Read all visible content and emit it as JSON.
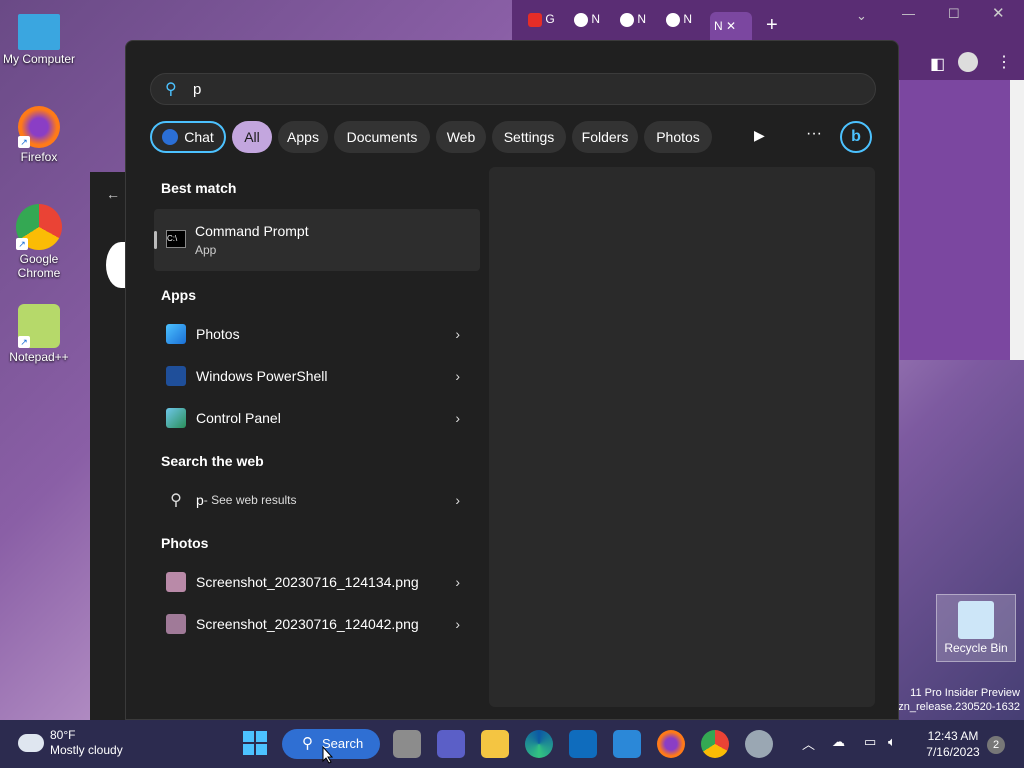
{
  "desktop": {
    "icons": [
      {
        "label": "My Computer"
      },
      {
        "label": "Firefox"
      },
      {
        "label": "Google Chrome"
      },
      {
        "label": "Notepad++"
      }
    ],
    "recycle_bin": "Recycle Bin",
    "watermark_line1": "11 Pro Insider Preview",
    "watermark_line2": "o.zn_release.230520-1632"
  },
  "browser": {
    "tabs": [
      "G",
      "N",
      "N",
      "N",
      "N"
    ],
    "new_tab": "+"
  },
  "search": {
    "query": "p",
    "filters": [
      "Chat",
      "All",
      "Apps",
      "Documents",
      "Web",
      "Settings",
      "Folders",
      "Photos"
    ],
    "active_filter": "All",
    "more": "···",
    "sections": {
      "best_match": "Best match",
      "apps": "Apps",
      "search_web": "Search the web",
      "photos": "Photos"
    },
    "best_match": {
      "title": "Command Prompt",
      "subtitle": "App"
    },
    "apps": [
      {
        "label": "Photos"
      },
      {
        "label": "Windows PowerShell"
      },
      {
        "label": "Control Panel"
      }
    ],
    "web": {
      "query": "p",
      "suffix": " - See web results"
    },
    "photos": [
      {
        "label": "Screenshot_20230716_124134.png"
      },
      {
        "label": "Screenshot_20230716_124042.png"
      }
    ]
  },
  "taskbar": {
    "weather_temp": "80°F",
    "weather_desc": "Mostly cloudy",
    "search_label": "Search",
    "time": "12:43 AM",
    "date": "7/16/2023",
    "notifications": "2"
  }
}
